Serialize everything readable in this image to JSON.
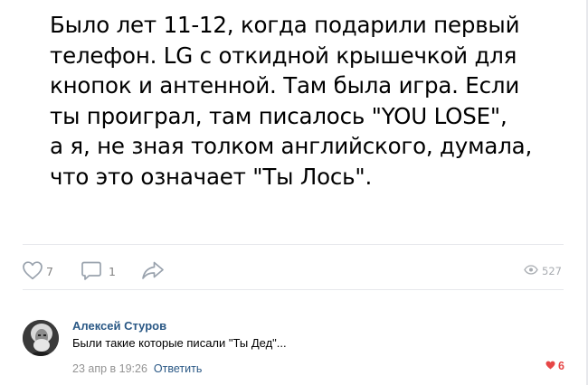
{
  "post": {
    "text": "Было лет 11-12, когда подарили первый\nтелефон. LG с откидной крышечкой для\nкнопок и антенной. Там была игра. Если\nты проиграл, там писалось \"YOU LOSE\",\nа я, не зная толком английского, думала,\nчто это означает \"Ты Лось\"."
  },
  "actions": {
    "like_icon": "heart-outline-icon",
    "likes": "7",
    "comment_icon": "comment-bubble-icon",
    "comments": "1",
    "share_icon": "share-arrow-icon",
    "views_icon": "eye-icon",
    "views": "527"
  },
  "comment": {
    "author": "Алексей Стуров",
    "text": "Были такие которые писали \"Ты Дед\"...",
    "date": "23 апр в 19:26",
    "reply_label": "Ответить",
    "likes": "6",
    "like_icon": "heart-filled-icon"
  },
  "colors": {
    "link": "#2a5885",
    "icon": "#99a2ad",
    "muted": "#939393",
    "like_active": "#e64646"
  }
}
